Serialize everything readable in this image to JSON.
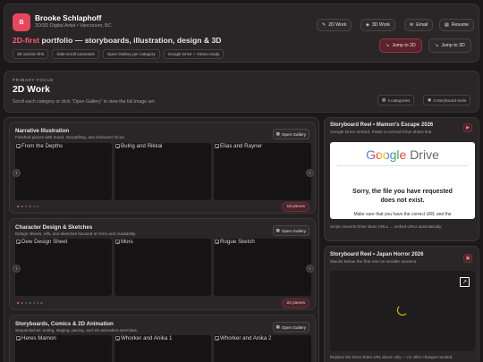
{
  "header": {
    "avatar_letter": "B",
    "name": "Brooke Schlaphoff",
    "subtitle": "2D/3D Digital Artist • Vancouver, BC",
    "tagline_accent": "2D-first",
    "tagline_rest": "portfolio — storyboards, illustration, design & 3D",
    "chips": [
      "2D section first",
      "Side-scroll carousels",
      "Open Gallery per category",
      "Google Drive + Vimeo ready"
    ],
    "buttons": {
      "work2d": "2D Work",
      "work3d": "3D Work",
      "email": "Email",
      "resume": "Resume",
      "jump2d": "Jump to 2D",
      "jump3d": "Jump to 3D"
    }
  },
  "focus": {
    "kicker": "PRIMARY FOCUS",
    "title": "2D Work",
    "desc": "Scroll each category or click \"Open Gallery\" to view the full image set.",
    "categories": "4 categories",
    "reels": "3 storyboard reels"
  },
  "sections": [
    {
      "title": "Narrative Illustration",
      "sub": "Finished pieces with mood, storytelling, and character focus.",
      "gallery": "Open Gallery",
      "thumbs": [
        "From the Depths",
        "Bulrig and Rikkal",
        "Elias and Rayner"
      ],
      "count": "19 pieces"
    },
    {
      "title": "Character Design & Sketches",
      "sub": "Design sheets, refs, and sketches focused on form and readability.",
      "gallery": "Open Gallery",
      "thumbs": [
        "Dew Design Sheet",
        "Mors",
        "Rogue Sketch"
      ],
      "count": "22 pieces"
    },
    {
      "title": "Storyboards, Comics & 2D Animation",
      "sub": "Sequential art: acting, staging, pacing, and 2D animation exercises.",
      "gallery": "Open Gallery",
      "thumbs": [
        "Heres Mamon",
        "Whorker and Anika 1",
        "Whorker and Anika 2"
      ]
    }
  ],
  "reel1": {
    "title": "Storyboard Reel • Mamon's Escape 2026",
    "sub": "Google Drive embed. Paste a normal Drive share link.",
    "drive_logo_google": "Google",
    "drive_logo_drive": "Drive",
    "error_line1": "Sorry, the file you have requested",
    "error_line2": "does not exist.",
    "error_line3": "Make sure that you have the correct URL and the",
    "note": "Script converts Drive share URLs → embed URLs automatically."
  },
  "reel2": {
    "title": "Storyboard Reel • Japan Horror 2026",
    "sub": "Stacks below the first reel on smaller screens.",
    "note": "Replace the Drive share URL above only — no other changes needed."
  },
  "colors": {
    "accent": "#ff5c6e",
    "background": "#1b1819",
    "card": "#2a2627"
  }
}
